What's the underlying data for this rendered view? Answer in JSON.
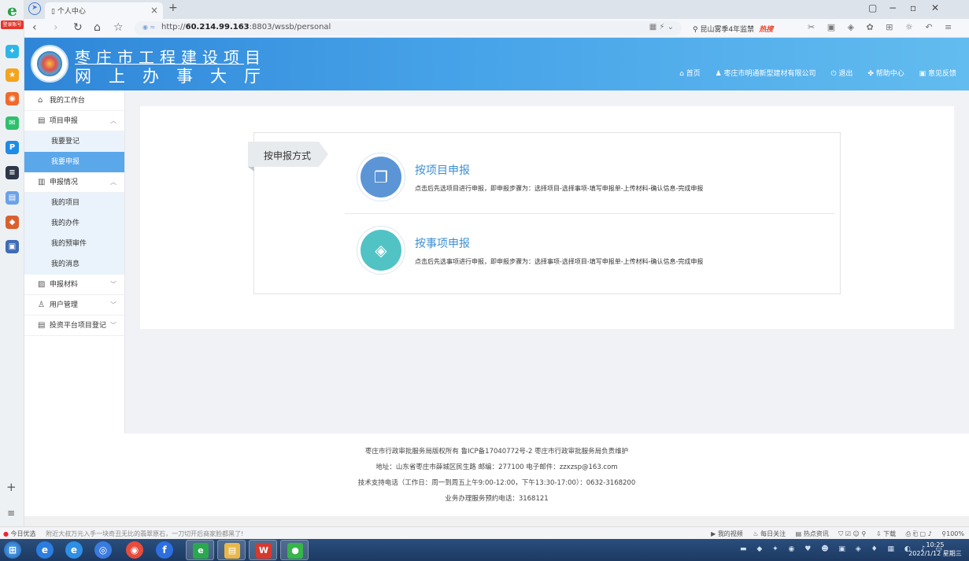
{
  "browser": {
    "brand_tag": "登录账号",
    "tab_title": "个人中心",
    "url_prefix": "http://",
    "url_host": "60.214.99.163",
    "url_path": ":8803/wssb/personal",
    "search_text": "昆山雾季4年监禁",
    "search_hot": "热搜",
    "window_controls": [
      "▢",
      "−",
      "▫",
      "✕"
    ]
  },
  "header": {
    "title_line1": "枣庄市工程建设项目",
    "title_line2": "网上办事大厅",
    "nav": {
      "home": "首页",
      "company": "枣庄市明通新型建材有限公司",
      "logout": "退出",
      "help": "帮助中心",
      "feedback": "意见反馈"
    }
  },
  "menu": {
    "workbench": "我的工作台",
    "project_declare": "项目申报",
    "register": "我要登记",
    "declare": "我要申报",
    "declare_status": "申报情况",
    "my_projects": "我的项目",
    "my_tasks": "我的办件",
    "my_pretrial": "我的预审件",
    "my_messages": "我的消息",
    "materials": "申报材料",
    "user_mgmt": "用户管理",
    "invest_register": "投资平台项目登记"
  },
  "main": {
    "section_tag": "按申报方式",
    "option_project": {
      "title": "按项目申报",
      "desc": "点击后先选项目进行申报，即申报步骤为：选择项目-选择事项-填写申报单-上传材料-确认信息-完成申报"
    },
    "option_item": {
      "title": "按事项申报",
      "desc": "点击后先选事项进行申报，即申报步骤为：选择事项-选择项目-填写申报单-上传材料-确认信息-完成申报"
    }
  },
  "footer": {
    "line1": "枣庄市行政审批服务局版权所有  鲁ICP备17040772号-2  枣庄市行政审批服务局负责维护",
    "line2": "地址：山东省枣庄市薛城区民生路 邮编：277100 电子邮件：zzxzsp@163.com",
    "line3": "技术支持电话（工作日：周一到周五上午9:00-12:00，下午13:30-17:00）：0632-3168200",
    "line4": "业务办理服务预约电话：3168121"
  },
  "statusbar": {
    "left_label": "今日优选",
    "news": "附近大叔万元入手一块奇丑无比的翡翠原石，一刀切开后商家脸都黑了!",
    "videos": "我的视频",
    "daily": "每日关注",
    "hotnews": "热点资讯",
    "download": "下载",
    "zoom": "100%"
  },
  "taskbar": {
    "time": "10:25",
    "date": "2022/1/12 星期三"
  },
  "colors": {
    "header_blue": "#2f86d8",
    "active_menu": "#5aa7ea",
    "project_circle": "#5b95d6",
    "item_circle": "#52c3c5",
    "title_blue": "#3c8fd6"
  }
}
